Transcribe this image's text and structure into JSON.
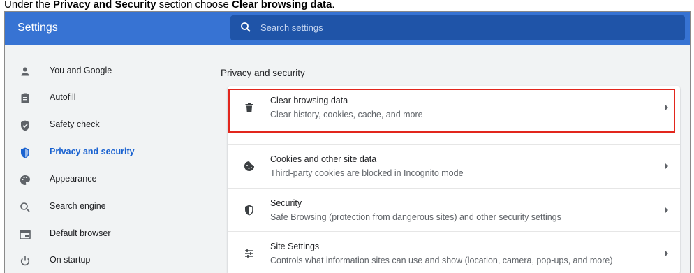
{
  "instruction": {
    "prefix": "Under the ",
    "section": "Privacy and Security",
    "middle": " section choose ",
    "target": "Clear browsing data",
    "suffix": "."
  },
  "header": {
    "title": "Settings",
    "search_placeholder": "Search settings"
  },
  "sidebar": {
    "items": [
      {
        "label": "You and Google",
        "icon": "person-icon"
      },
      {
        "label": "Autofill",
        "icon": "clipboard-icon"
      },
      {
        "label": "Safety check",
        "icon": "shield-check-icon"
      },
      {
        "label": "Privacy and security",
        "icon": "shield-icon",
        "active": true
      },
      {
        "label": "Appearance",
        "icon": "palette-icon"
      },
      {
        "label": "Search engine",
        "icon": "search-icon"
      },
      {
        "label": "Default browser",
        "icon": "browser-window-icon"
      },
      {
        "label": "On startup",
        "icon": "power-icon"
      }
    ]
  },
  "main": {
    "heading": "Privacy and security",
    "rows": [
      {
        "title": "Clear browsing data",
        "subtitle": "Clear history, cookies, cache, and more",
        "icon": "trash-icon"
      },
      {
        "title": "Cookies and other site data",
        "subtitle": "Third-party cookies are blocked in Incognito mode",
        "icon": "cookie-icon"
      },
      {
        "title": "Security",
        "subtitle": "Safe Browsing (protection from dangerous sites) and other security settings",
        "icon": "shield-icon"
      },
      {
        "title": "Site Settings",
        "subtitle": "Controls what information sites can use and show (location, camera, pop-ups, and more)",
        "icon": "sliders-icon"
      }
    ]
  },
  "colors": {
    "header_blue": "#3773d3",
    "search_blue": "#1f54a8",
    "active_blue": "#1a62d0",
    "highlight_red": "#e2261d"
  }
}
